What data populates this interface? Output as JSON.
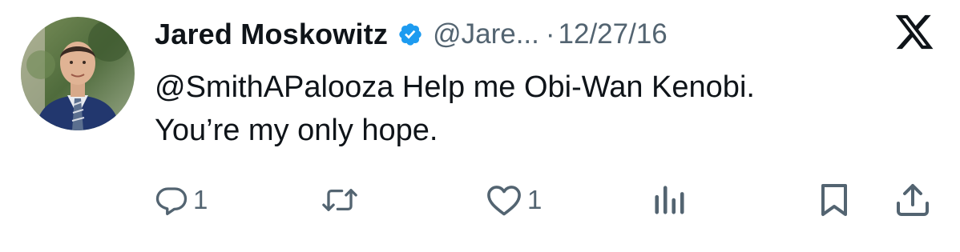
{
  "author": {
    "display_name": "Jared Moskowitz",
    "handle": "@Jare...",
    "separator": "·",
    "date": "12/27/16",
    "verified": true
  },
  "tweet": {
    "line1": "@SmithAPalooza Help me Obi-Wan Kenobi.",
    "line2": "You’re my only hope."
  },
  "actions": {
    "reply_count": "1",
    "retweet_count": "",
    "like_count": "1"
  },
  "icons": {
    "verified": "verified-badge-icon",
    "platform": "x-logo-icon",
    "reply": "reply-icon",
    "retweet": "retweet-icon",
    "like": "heart-icon",
    "views": "views-icon",
    "bookmark": "bookmark-icon",
    "share": "share-icon"
  },
  "colors": {
    "text": "#0f1419",
    "secondary": "#536471",
    "verified": "#1d9bf0",
    "icon": "#536471",
    "background": "#ffffff"
  }
}
